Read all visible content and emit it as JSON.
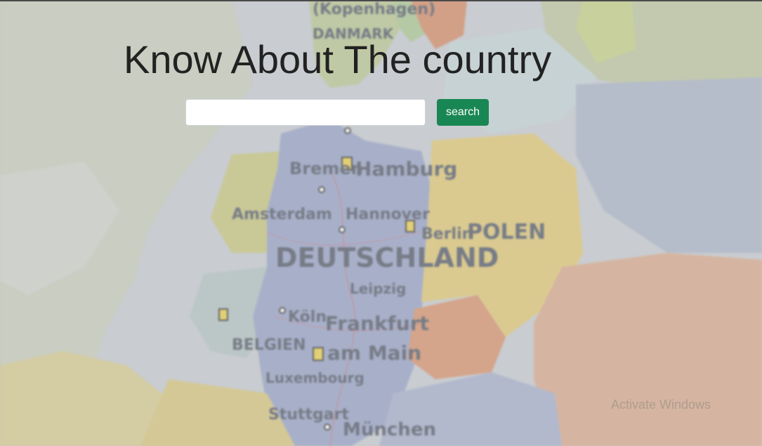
{
  "header": {
    "title": "Know About The country"
  },
  "search": {
    "value": "",
    "placeholder": "",
    "button_label": "search"
  },
  "background": {
    "description_icon": "map-image",
    "map_labels": {
      "kopenhagen": "(Kopenhagen)",
      "danmark": "DANMARK",
      "bremen": "Bremen",
      "hamburg": "Hamburg",
      "hannover": "Hannover",
      "amsterdam": "Amsterdam",
      "berlin": "Berlin",
      "polen": "POLEN",
      "deutschland": "DEUTSCHLAND",
      "leipzig": "Leipzig",
      "koln": "Köln",
      "frankfurt": "Frankfurt",
      "am_main": "am Main",
      "belgien": "BELGIEN",
      "luxembourg": "Luxembourg",
      "stuttgart": "Stuttgart",
      "munchen": "München"
    }
  },
  "watermark": {
    "text": "Activate Windows"
  },
  "colors": {
    "button_bg": "#198754",
    "title_text": "#222222"
  }
}
